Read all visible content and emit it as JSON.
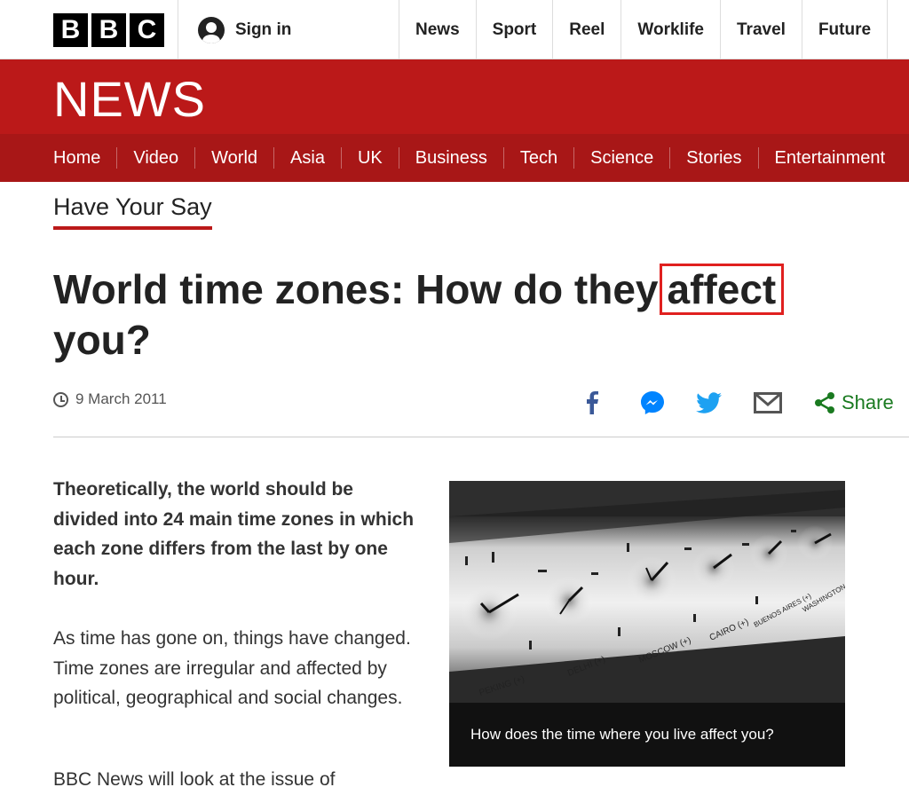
{
  "header": {
    "logo_letters": [
      "B",
      "B",
      "C"
    ],
    "sign_in": "Sign in",
    "nav": [
      "News",
      "Sport",
      "Reel",
      "Worklife",
      "Travel",
      "Future"
    ]
  },
  "banner": {
    "title": "NEWS",
    "color": "#bb1919",
    "subnav": [
      "Home",
      "Video",
      "World",
      "Asia",
      "UK",
      "Business",
      "Tech",
      "Science",
      "Stories",
      "Entertainment"
    ]
  },
  "section": "Have Your Say",
  "article": {
    "headline_pre": "World time zones: How do they",
    "headline_highlight": "affect",
    "headline_post": "you?",
    "date": "9 March 2011",
    "share_label": "Share",
    "share_icons": [
      "facebook-icon",
      "messenger-icon",
      "twitter-icon",
      "email-icon",
      "share-icon"
    ],
    "intro": "Theoretically, the world should be divided into 24 main time zones in which each zone differs from the last by one hour.",
    "paragraphs": [
      "As time has gone on, things have changed. Time zones are irregular and affected by political, geographical and social changes.",
      "BBC News will look at the issue of"
    ]
  },
  "figure": {
    "clock_labels": [
      "PEKING (+)",
      "DELHI (+)",
      "MOSCOW (+)",
      "CAIRO (+)",
      "BUENOS AIRES (+)",
      "WASHINGTON (+)"
    ],
    "caption": "How does the time where you live affect you?"
  },
  "colors": {
    "accent": "#bb1919",
    "highlight_box": "#e0201f",
    "share_green": "#1a7a20",
    "facebook": "#3b5998",
    "messenger": "#0084ff",
    "twitter": "#1da1f2"
  }
}
